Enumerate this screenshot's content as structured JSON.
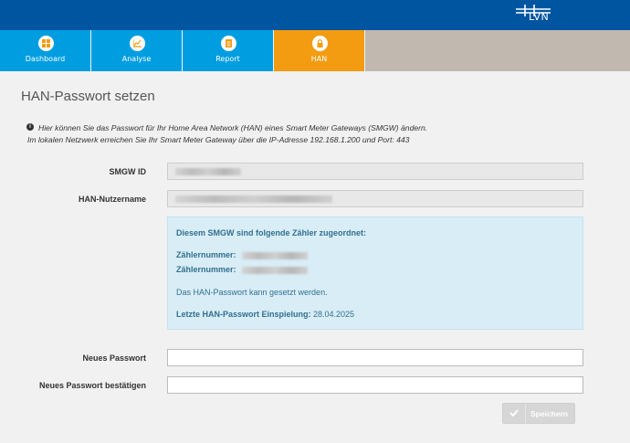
{
  "brand": {
    "logo_text": "LVN"
  },
  "nav": {
    "items": [
      {
        "label": "Dashboard",
        "icon": "dashboard-grid-icon"
      },
      {
        "label": "Analyse",
        "icon": "chart-icon"
      },
      {
        "label": "Report",
        "icon": "document-icon"
      },
      {
        "label": "HAN",
        "icon": "lock-icon",
        "active": true
      }
    ]
  },
  "page": {
    "title": "HAN-Passwort setzen",
    "info_line1": "Hier können Sie das Passwort für Ihr Home Area Network (HAN) eines Smart Meter Gateways (SMGW) ändern.",
    "info_line2": "Im lokalen Netzwerk erreichen Sie Ihr Smart Meter Gateway über die IP-Adresse 192.168.1.200 und Port: 443"
  },
  "form": {
    "smgw_id_label": "SMGW ID",
    "han_user_label": "HAN-Nutzername",
    "new_pw_label": "Neues Passwort",
    "confirm_pw_label": "Neues Passwort bestätigen"
  },
  "panel": {
    "title": "Diesem SMGW sind folgende Zähler zugeordnet:",
    "meter_label": "Zählernummer:",
    "message": "Das HAN-Passwort kann gesetzt werden.",
    "last_label": "Letzte HAN-Passwort Einspielung:",
    "last_value": " 28.04.2025"
  },
  "actions": {
    "save_label": "Speichern"
  },
  "colors": {
    "topbar": "#0055a0",
    "nav": "#009ee0",
    "nav_active": "#f39c12",
    "nav_fill": "#c1b8b0",
    "panel_bg": "#d9edf7",
    "panel_text": "#31708f"
  }
}
